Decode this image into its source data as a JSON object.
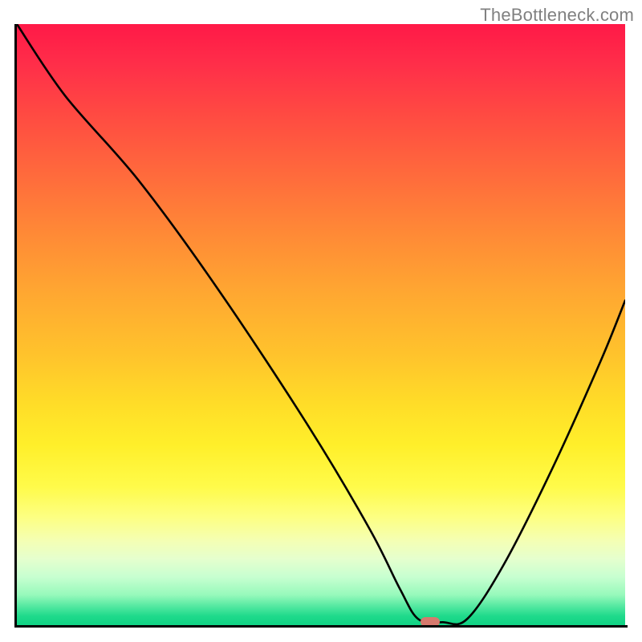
{
  "watermark": "TheBottleneck.com",
  "chart_data": {
    "type": "line",
    "title": "",
    "xlabel": "",
    "ylabel": "",
    "xlim": [
      0,
      100
    ],
    "ylim": [
      0,
      100
    ],
    "grid": false,
    "legend": false,
    "series": [
      {
        "name": "bottleneck-curve",
        "x": [
          0,
          8,
          20,
          33,
          48,
          58,
          63,
          66,
          70,
          74,
          80,
          88,
          96,
          100
        ],
        "values": [
          100,
          88,
          74,
          56,
          33,
          16,
          6,
          1,
          0.5,
          1,
          10,
          26,
          44,
          54
        ]
      }
    ],
    "gradient_stops": [
      {
        "pos": 0.0,
        "color": "#ff1948"
      },
      {
        "pos": 0.5,
        "color": "#ffb82e"
      },
      {
        "pos": 0.78,
        "color": "#fffd55"
      },
      {
        "pos": 1.0,
        "color": "#10d284"
      }
    ],
    "optimum_marker": {
      "x": 68,
      "y": 0,
      "color": "#d6796d"
    }
  }
}
